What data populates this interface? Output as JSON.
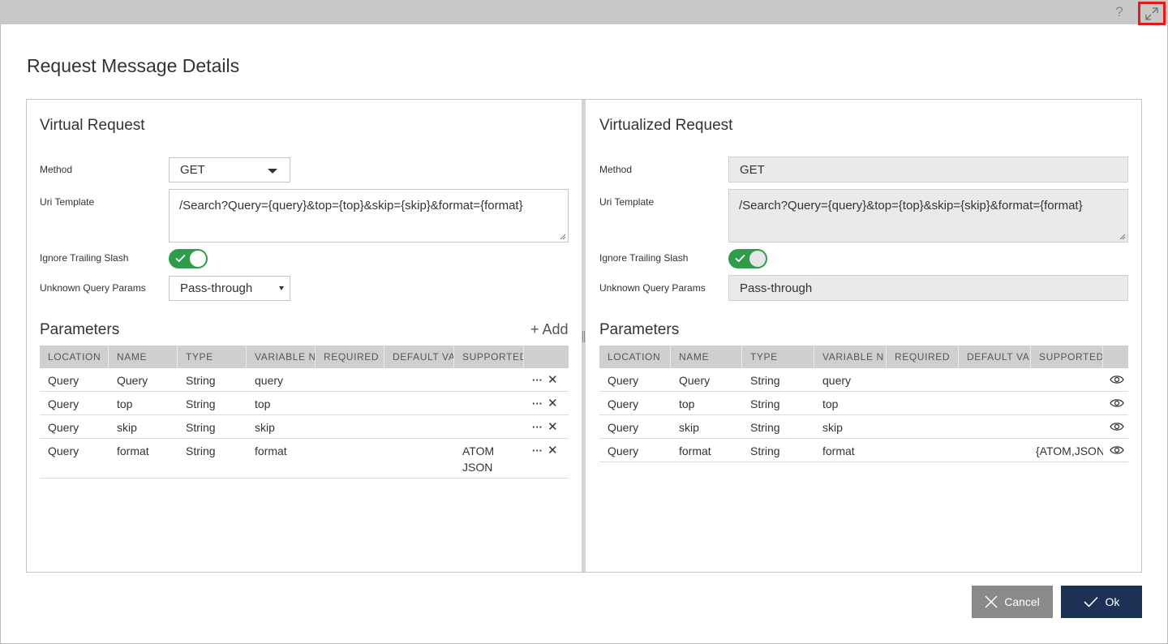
{
  "window": {
    "help_label": "?",
    "expand_icon": "expand-arrows-icon"
  },
  "dialog": {
    "title": "Request Message Details"
  },
  "left_panel": {
    "title": "Virtual Request",
    "method_label": "Method",
    "method_value": "GET",
    "uri_label": "Uri Template",
    "uri_value": "/Search?Query={query}&top={top}&skip={skip}&format={format}",
    "slash_label": "Ignore Trailing Slash",
    "slash_on": true,
    "unknown_label": "Unknown Query Params",
    "unknown_value": "Pass-through",
    "params_title": "Parameters",
    "add_label": "+ Add",
    "columns": [
      "LOCATION",
      "NAME",
      "TYPE",
      "VARIABLE N",
      "REQUIRED",
      "DEFAULT VA",
      "SUPPORTED",
      ""
    ],
    "rows": [
      {
        "location": "Query",
        "name": "Query",
        "type": "String",
        "variable": "query",
        "required": "",
        "default": "",
        "supported": ""
      },
      {
        "location": "Query",
        "name": "top",
        "type": "String",
        "variable": "top",
        "required": "",
        "default": "",
        "supported": ""
      },
      {
        "location": "Query",
        "name": "skip",
        "type": "String",
        "variable": "skip",
        "required": "",
        "default": "",
        "supported": ""
      },
      {
        "location": "Query",
        "name": "format",
        "type": "String",
        "variable": "format",
        "required": "",
        "default": "",
        "supported": "ATOM JSON"
      }
    ],
    "more_glyph": "···",
    "delete_glyph": "✕"
  },
  "right_panel": {
    "title": "Virtualized Request",
    "method_label": "Method",
    "method_value": "GET",
    "uri_label": "Uri Template",
    "uri_value": "/Search?Query={query}&top={top}&skip={skip}&format={format}",
    "slash_label": "Ignore Trailing Slash",
    "slash_on": true,
    "unknown_label": "Unknown Query Params",
    "unknown_value": "Pass-through",
    "params_title": "Parameters",
    "columns": [
      "LOCATION",
      "NAME",
      "TYPE",
      "VARIABLE N",
      "REQUIRED",
      "DEFAULT VA",
      "SUPPORTED",
      ""
    ],
    "rows": [
      {
        "location": "Query",
        "name": "Query",
        "type": "String",
        "variable": "query",
        "required": "",
        "default": "",
        "supported": ""
      },
      {
        "location": "Query",
        "name": "top",
        "type": "String",
        "variable": "top",
        "required": "",
        "default": "",
        "supported": ""
      },
      {
        "location": "Query",
        "name": "skip",
        "type": "String",
        "variable": "skip",
        "required": "",
        "default": "",
        "supported": ""
      },
      {
        "location": "Query",
        "name": "format",
        "type": "String",
        "variable": "format",
        "required": "",
        "default": "",
        "supported": "{ATOM,JSON"
      }
    ]
  },
  "footer": {
    "cancel_label": "Cancel",
    "ok_label": "Ok"
  },
  "colors": {
    "toggle_on": "#2e9c4a",
    "ok_button": "#1d3155",
    "cancel_button": "#8a8a8a",
    "highlight_frame": "#e01b1b"
  }
}
